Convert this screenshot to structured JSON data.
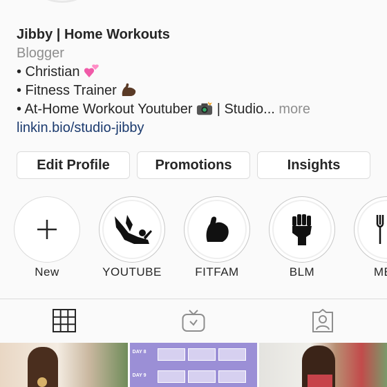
{
  "profile": {
    "name": "Jibby | Home Workouts",
    "category": "Blogger",
    "bio_lines": [
      {
        "text": "• Christian",
        "icon": "pink-hearts-emoji"
      },
      {
        "text": "• Fitness Trainer",
        "icon": "flexed-biceps-emoji"
      },
      {
        "text": "• At-Home Workout Youtuber",
        "icon": "camera-emoji",
        "suffix": " | Studio...",
        "more": "more"
      }
    ],
    "link": "linkin.bio/studio-jibby"
  },
  "buttons": {
    "edit_profile": "Edit Profile",
    "promotions": "Promotions",
    "insights": "Insights"
  },
  "highlights": [
    {
      "label": "New",
      "icon": "plus-icon"
    },
    {
      "label": "YOUTUBE",
      "icon": "workout-pose-icon"
    },
    {
      "label": "FITFAM",
      "icon": "flexed-arm-icon"
    },
    {
      "label": "BLM",
      "icon": "raised-fist-icon"
    },
    {
      "label": "MEA",
      "icon": "fork-knife-icon"
    }
  ],
  "tabs": [
    {
      "name": "posts-grid",
      "icon": "grid-icon",
      "active": true
    },
    {
      "name": "igtv",
      "icon": "igtv-icon",
      "active": false
    },
    {
      "name": "tagged",
      "icon": "tagged-person-icon",
      "active": false
    }
  ],
  "grid_posts": [
    {
      "type": "photo"
    },
    {
      "type": "schedule",
      "tags": [
        "DAY 8",
        "DAY 9"
      ]
    },
    {
      "type": "photo"
    }
  ],
  "colors": {
    "link": "#1b3a6e",
    "secondary_text": "#8e8e8e",
    "border": "#dbdbdb"
  }
}
